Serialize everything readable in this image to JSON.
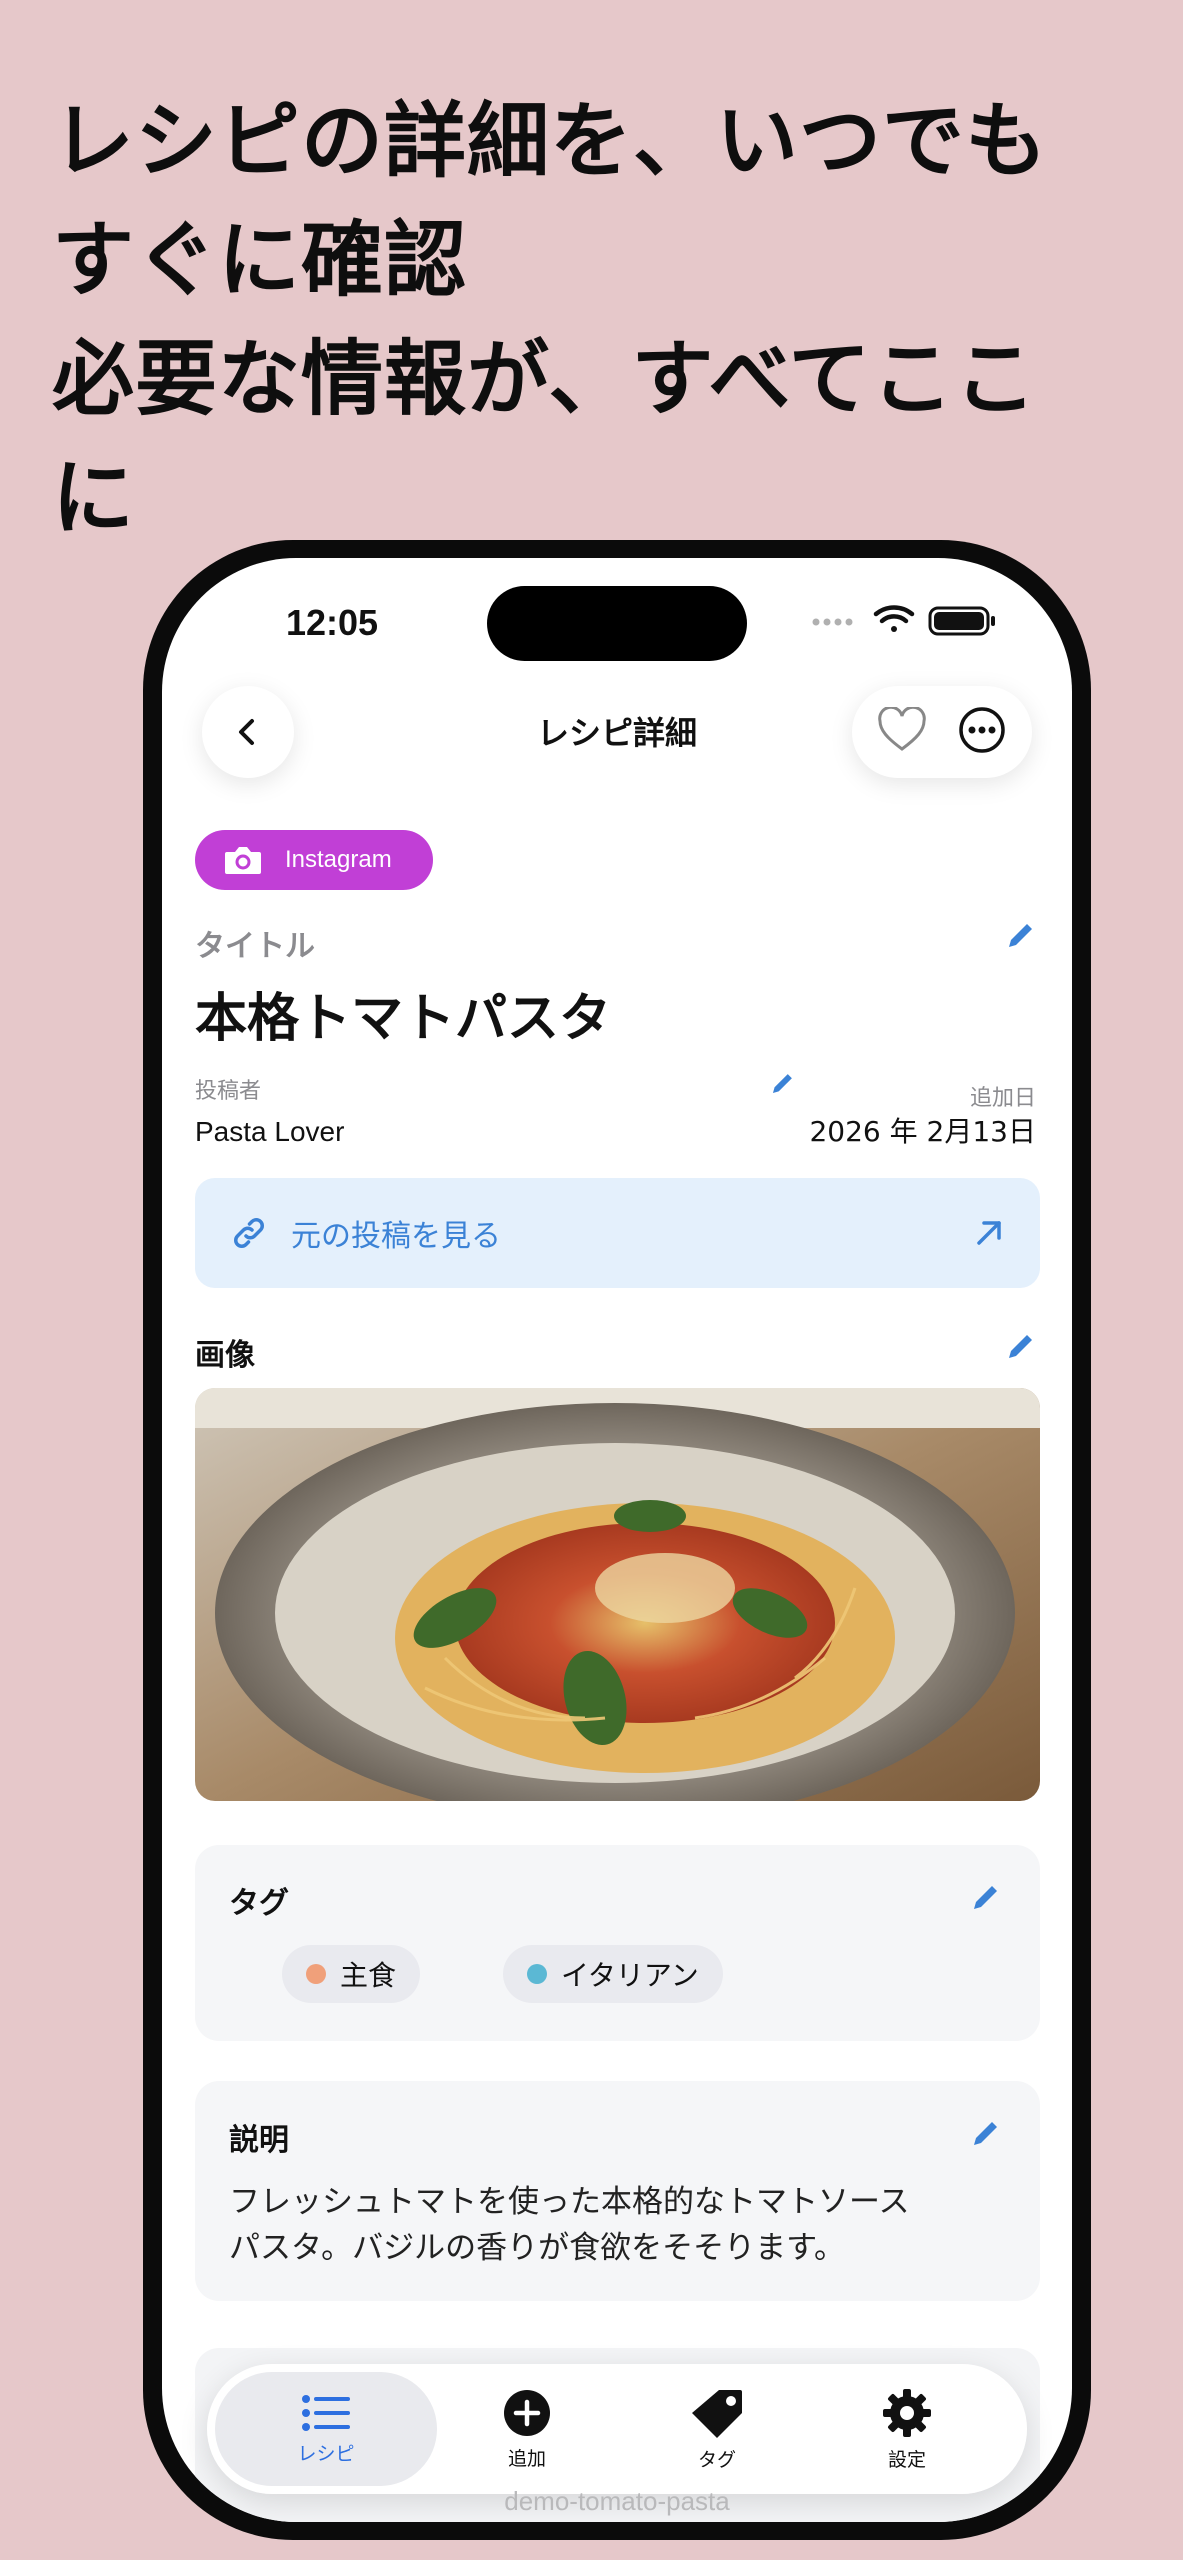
{
  "headline": {
    "lines": [
      "レシピの詳細を、いつでも",
      "すぐに確認",
      "必要な情報が、すべてここ",
      "に"
    ]
  },
  "status_bar": {
    "time": "12:05"
  },
  "nav": {
    "title": "レシピ詳細",
    "back_icon": "chevron-left-icon",
    "favorite_icon": "heart-icon",
    "more_icon": "ellipsis-circle-icon"
  },
  "source_badge": {
    "label": "Instagram",
    "icon": "camera-icon",
    "color": "#c13fd6"
  },
  "title_section": {
    "label": "タイトル",
    "value": "本格トマトパスタ"
  },
  "author": {
    "label": "投稿者",
    "value": "Pasta Lover"
  },
  "added_date": {
    "label": "追加日",
    "value": "2026 年 2月13日"
  },
  "source_link": {
    "label": "元の投稿を見る",
    "color": "#3b82d6"
  },
  "image_section": {
    "heading": "画像"
  },
  "tags_section": {
    "heading": "タグ",
    "tags": [
      {
        "label": "主食",
        "color": "#f0a07a"
      },
      {
        "label": "イタリアン",
        "color": "#5bb8d4"
      }
    ]
  },
  "description_section": {
    "heading": "説明",
    "lines": [
      "フレッシュトマトを使った本格的なトマトソース",
      "パスタ。バジルの香りが食欲をそそります。"
    ]
  },
  "tabbar": {
    "accent": "#2d6fe0",
    "tabs": [
      {
        "label": "レシピ",
        "icon": "list-icon",
        "active": true
      },
      {
        "label": "追加",
        "icon": "plus-circle-icon",
        "active": false
      },
      {
        "label": "タグ",
        "icon": "tag-icon",
        "active": false
      },
      {
        "label": "設定",
        "icon": "gear-icon",
        "active": false
      }
    ]
  },
  "footer_url": "demo-tomato-pasta"
}
